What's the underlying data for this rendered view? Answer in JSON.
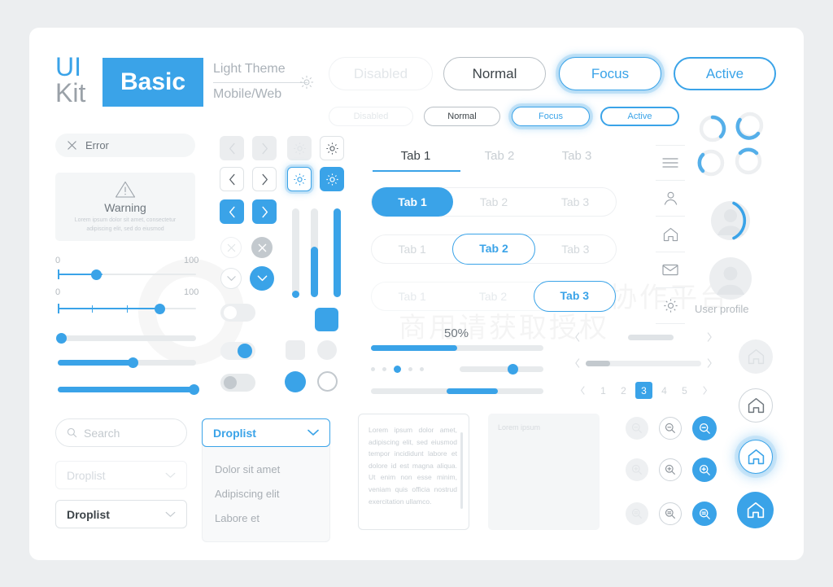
{
  "header": {
    "brand_ui": "UI",
    "brand_kit": "Kit",
    "badge": "Basic",
    "theme": "Light Theme",
    "platform": "Mobile/Web",
    "sun_icon": "sun-icon"
  },
  "colors": {
    "accent": "#3aa3e8",
    "text": "#3d4449",
    "muted": "#b4babf",
    "disabled": "#e3e7ea",
    "surface": "#f4f6f7",
    "page_bg": "#eceef0",
    "card_bg": "#ffffff"
  },
  "buttons": {
    "large": [
      {
        "label": "Disabled",
        "state": "disabled"
      },
      {
        "label": "Normal",
        "state": "normal"
      },
      {
        "label": "Focus",
        "state": "focus"
      },
      {
        "label": "Active",
        "state": "active"
      }
    ],
    "small": [
      {
        "label": "Disabled",
        "state": "disabled"
      },
      {
        "label": "Normal",
        "state": "normal"
      },
      {
        "label": "Focus",
        "state": "focus"
      },
      {
        "label": "Active",
        "state": "active"
      }
    ]
  },
  "alerts": {
    "error": {
      "label": "Error",
      "icon": "close-icon"
    },
    "warning": {
      "icon": "warning-triangle-icon",
      "title": "Warning",
      "body": "Lorem ipsum dolor sit amet, consectetur adipiscing elit, sed do eiusmod"
    }
  },
  "sliders": {
    "range_min": "0",
    "range_max": "100",
    "values": [
      32,
      73,
      0,
      56,
      100
    ],
    "vertical_values": [
      0,
      62,
      100
    ]
  },
  "tabs": {
    "underline_row": {
      "items": [
        "Tab 1",
        "Tab 2",
        "Tab 3"
      ],
      "selected": 0
    },
    "filled_row": {
      "items": [
        "Tab 1",
        "Tab 2",
        "Tab 3"
      ],
      "selected": 0
    },
    "outline_row": {
      "items": [
        "Tab 1",
        "Tab 2",
        "Tab 3"
      ],
      "selected": 1
    },
    "ghost_row": {
      "items": [
        "Tab 1",
        "Tab 2",
        "Tab 3"
      ],
      "selected": 2
    }
  },
  "progress": {
    "percent_label": "50%",
    "percent_value": 50,
    "dots_count": 5,
    "dots_active": 2
  },
  "pagination": {
    "prev_icon": "chevron-left-icon",
    "next_icon": "chevron-right-icon",
    "pages": [
      "1",
      "2",
      "3",
      "4",
      "5"
    ],
    "current": "3"
  },
  "sidebar": {
    "items": [
      {
        "icon": "menu-icon",
        "name": "menu"
      },
      {
        "icon": "user-icon",
        "name": "user"
      },
      {
        "icon": "home-icon",
        "name": "home"
      },
      {
        "icon": "mail-icon",
        "name": "mail"
      },
      {
        "icon": "gear-icon",
        "name": "settings"
      }
    ]
  },
  "avatar": {
    "label": "User profile"
  },
  "fields": {
    "search": {
      "placeholder": "Search",
      "icon": "search-icon"
    },
    "droplist_disabled": {
      "value": "Droplist",
      "icon": "chevron-down-icon"
    },
    "droplist_normal": {
      "value": "Droplist",
      "icon": "chevron-down-icon"
    },
    "droplist_open": {
      "value": "Droplist",
      "icon": "chevron-down-icon",
      "options": [
        "Dolor sit amet",
        "Adipiscing elit",
        "Labore et"
      ]
    }
  },
  "textareas": {
    "filled": "Lorem ipsum dolor amet, adipiscing elit, sed eiusmod tempor incididunt labore et dolore id est magna aliqua. Ut enim non esse minim, veniam quis officia nostrud exercitation ullamco.",
    "placeholder": "Lorem ipsum"
  },
  "icon_buttons": {
    "chevron_left": "chevron-left-icon",
    "chevron_right": "chevron-right-icon",
    "gear": "gear-icon",
    "close": "close-icon",
    "check": "check-icon",
    "zoom_out": "zoom-out-icon",
    "zoom_in": "zoom-in-icon",
    "zoom_reset": "zoom-reset-icon",
    "home": "home-icon",
    "states": [
      "disabled",
      "normal",
      "focus",
      "active"
    ]
  },
  "watermark": {
    "line1": "营销创意服务与协作平台",
    "line2": "商用请获取授权"
  }
}
